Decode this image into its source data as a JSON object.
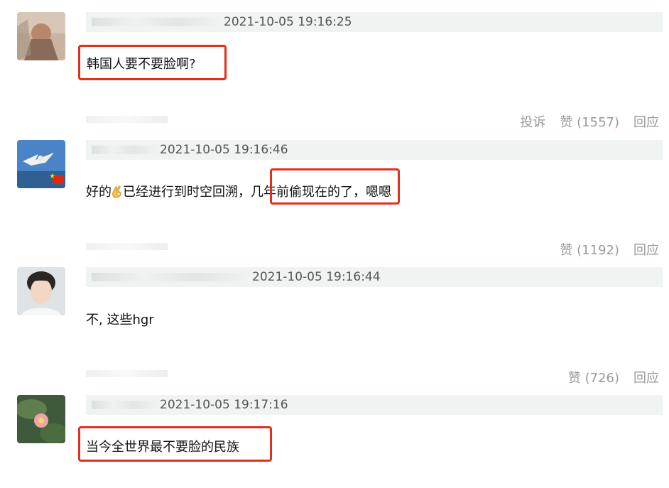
{
  "comments": [
    {
      "time": "2021-10-05 19:16:25",
      "text": "韩国人要不要脸啊?"
    },
    {
      "time": "2021-10-05 19:16:46",
      "text_a": "好的",
      "text_b": "已经进行到时空回溯，",
      "text_c": "几年前偷现在的了，",
      "text_d": "嗯嗯"
    },
    {
      "time": "2021-10-05 19:16:44",
      "text": "不,   这些hgr"
    },
    {
      "time": "2021-10-05 19:17:16",
      "text": "当今全世界最不要脸的民族"
    }
  ],
  "actions1": {
    "report": "投诉",
    "like": "赞 (1557)",
    "reply": "回应"
  },
  "actions2": {
    "like": "赞 (1192)",
    "reply": "回应"
  },
  "actions3": {
    "like": "赞 (726)",
    "reply": "回应"
  },
  "colors": {
    "highlight": "#e0301e",
    "meta_bg": "#eff3f2",
    "muted": "#999999"
  }
}
